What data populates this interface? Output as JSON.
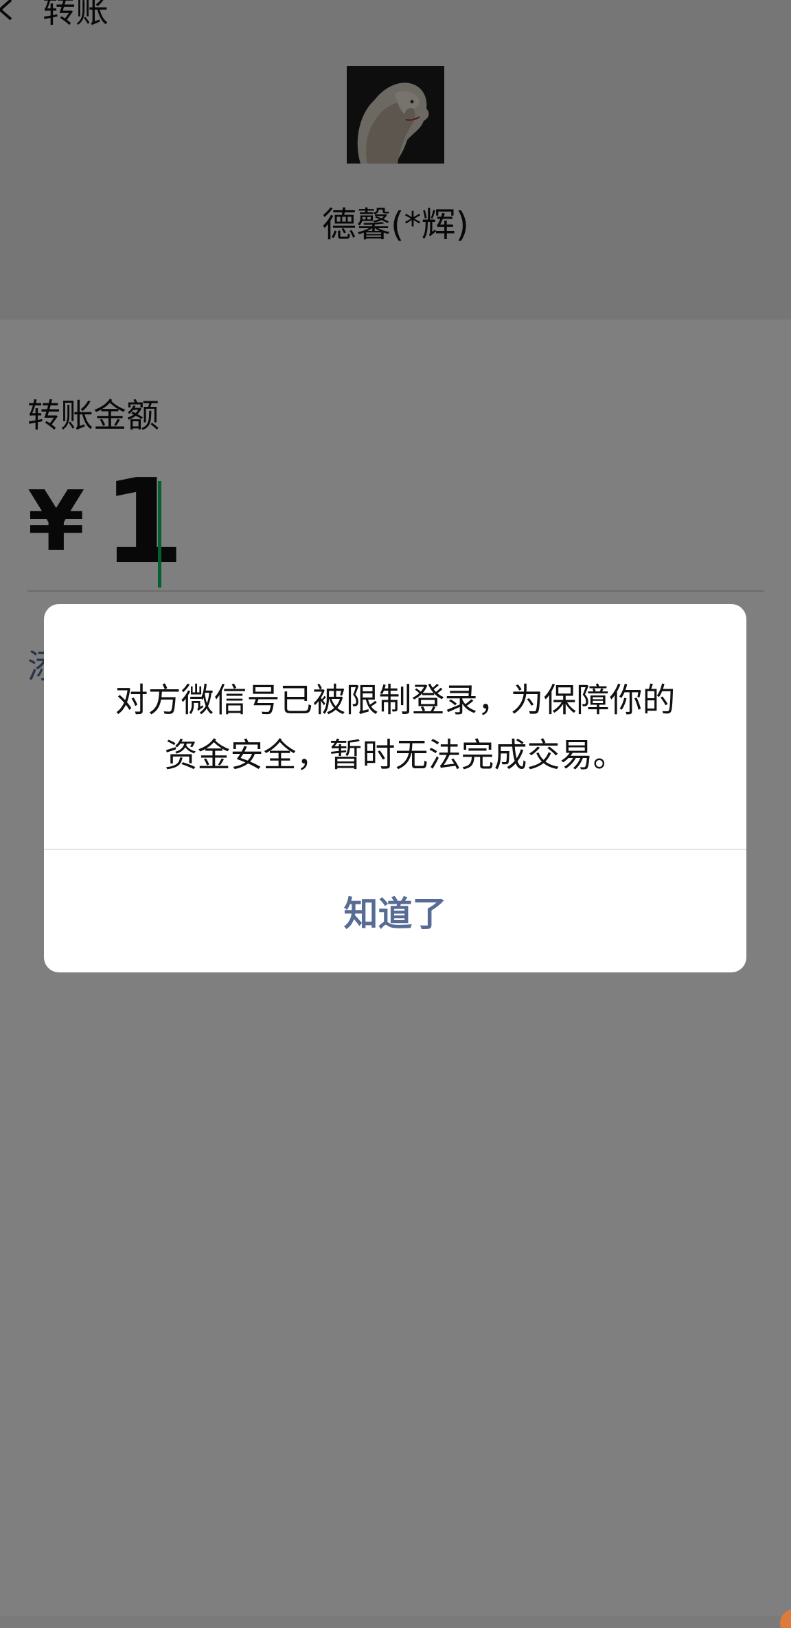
{
  "nav": {
    "back_icon": "chevron-left-icon",
    "title": "转账"
  },
  "payee": {
    "avatar_icon": "lion-avatar",
    "name": "德馨(*辉)"
  },
  "amount": {
    "label": "转账金额",
    "currency": "¥",
    "value": "1",
    "add_note_visible_fragment": "添"
  },
  "dialog": {
    "message": "对方微信号已被限制登录，为保障你的资金安全，暂时无法完成交易。",
    "button_label": "知道了"
  },
  "colors": {
    "link": "#576b95",
    "caret": "#07c160",
    "mask": "rgba(0,0,0,0.5)"
  }
}
